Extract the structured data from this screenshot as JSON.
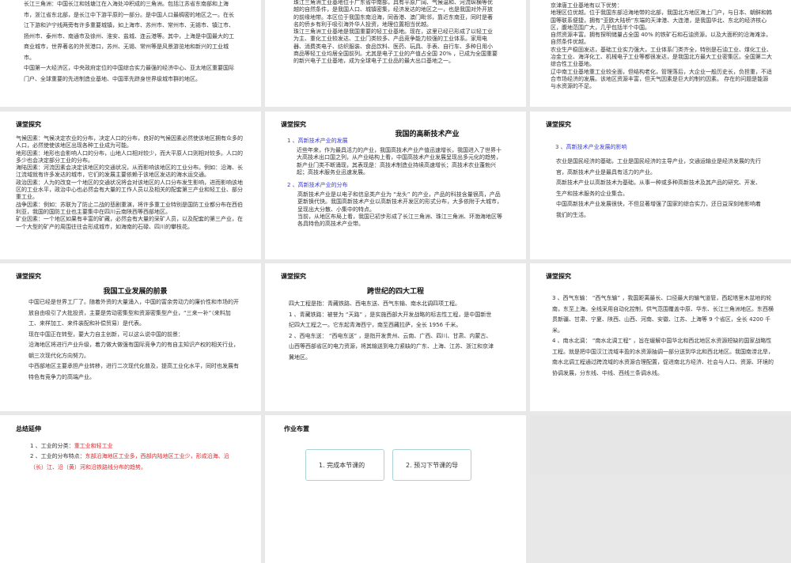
{
  "slides": {
    "s1": {
      "paragraphs": [
        "长江三角洲：中国长江和钱塘江在入海处冲积成的三角洲。包括江苏省东南部和上海市，浙江省东北部，是长江中下游平原的一部分。是中国人口最稠密的地区之一。在长江下游和沪宁线两旁有许多重要城镇，如上海市、苏州市、常州市、无锡市、镇江市、扬州市、泰州市、南通市及徐州、淮安、盐城、连云港等。其中，上海是中国最大的工商业城市，世界著名的外贸港口，苏州、无锡、常州等是风景游览地和新兴的工业城市。",
        "中国第一大经济区，中央政府定位的中国综合实力最强的经济中心、亚太地区重要国际门户、全球重要的先进制造业基地、中国率先跻身世界级城市群的地区。"
      ]
    },
    "s2": {
      "paragraphs": [
        "珠江三角洲工业基地位于广东省中南部，具有平原广阔、气候温和、河流纵横等优越的自然条件，是我国人口、城镇密集，经济发达的地区之一，也是我国对外开放的前缘地带。本区位于我国东南沿海，同香港、澳门毗邻，靠近东南亚，同时是著名的侨乡有利于吸引海外华人投资，地理位置相当优越。",
        "珠江三角洲工业基地是我国重要的轻工业基地。现在，这里已经已形成了以轻工业为主、重化工业较发达、工业门类较多、产品竞争能力较强的工业体系。家用电器、消费类电子、纺织服装、食品饮料、医药、玩具、手表、自行车、多种日用小商品等轻工业均居全国前列。尤其是电子工业的产值占全国 20% ，已成为全国重要的新兴电子工业基地，成为全球电子工业品的最大出口基地之一。"
      ]
    },
    "s3": {
      "paragraphs": [
        "京津唐工业基地有以下优势：",
        "地理区位优越。位于我国东部沿海地带的北部，我国北方地区海上门户，与日本、朝鲜和韩国等联系便捷，拥有“亚欧大陆桥”东端的天津港、大连港，是我国华北、东北的经济核心区，腹地范围广大，几乎包括半个中国。",
        "自然资源丰富。拥有探明储量占全国 40% 的铁矿石和石油资源，以及大面积的沿海滩涂，自然条件优越。",
        "农业生产稳固发达，基础工业实力强大，工业体系门类齐全，特别是石油工业、煤化工业、冶金工业、海洋化工、机械电子工业等都很发达，是我国北方最大工业密集区。全国第二大综合性工业基地。",
        "辽中南工业基地重工业较全面，但结构老化，管理落后，大企业一般历史长，负担重，不适合市场经济的发展。该地区资源丰富，但天气因素是巨大的制约因素。 存在的问题是能源与水资源的不足。"
      ]
    },
    "s4": {
      "header": "课堂探究",
      "paragraphs": [
        "气候因素：气候决定农业的分布，决定人口的分布，良好的气候因素必然使该地区拥有众多的人口，必然使使该地区出现各种工业成为可能。",
        "地形因素：地形也会影响人口的分布，山地人口相对较少，而大平原人口则相对较多。人口的多少也会决定部分工业的分布。",
        "海陆因素：河流因素会决定该地区的交通状况，从而影响该地区的工业分布。例如：沿海、长江流域就有许多发达的城市，它们的发展主要依赖于该地区发达的海水运交通。",
        "政治因素：人为的改变一个地区的交通状况将会对该地区的人口分布发生影响，进而影响该地区的工业水平，政治中心也必然会有大量的工作人员以及相关的配套第三产业和轻工业、部分重工业。",
        "战争因素：例如：苏联为了防止二战的悲剧重演，将许多重工业特别是国防工业都分布在西伯利亚，我国的国防工业也主要集中在四川云南陕西等西部地区。",
        "矿业因素：一个地区如果有丰富的矿藏，必然会有大量的采矿人员，以及配套的第三产业，在一个大型的矿产的周围往往会形成城市，如海南的石碌、四川的攀枝花。"
      ]
    },
    "s5": {
      "header": "课堂探究",
      "title": "我国的高新技术产业",
      "sub1": "1 、高新技术产业的发展",
      "p1": "近些年来，作为最具活力的产业，我国高技术产业产值迅速增长，我国进入了世界十大高技术出口国之列，从产业结构上看，中国高技术产业发展呈现出多元化的趋势，新产业门类不断涌现，其表现是：高技术制造业持续高速增长；高技术农业蓬勃兴起；高技术服务业迅速发展。",
      "sub2": "2 、高新技术产业的分布",
      "p2": "高新技术产业是以电子和信息类产业为 “龙头” 的产业，产品的科技含量很高，产品更新换代快。我国高新技术产业以高新技术开发区的形式分布，大多依附于大城市，呈现出大分散、小集中的特点。",
      "p3": "当前，从地区布局上看，我国已初步形成了长江三角洲、珠江三角洲、环渤海地区等各具特色的高技术产业带。"
    },
    "s6": {
      "header": "课堂探究",
      "sub": "3 、高新技术产业发展的影响",
      "paragraphs": [
        "农业是国民经济的基础，工业是国民经济的主导产业，交通运输业是经济发展的先行官，高新技术产业是最具有活力的产业。",
        "高新技术产业以高新技术为基础，从事一种或多种高新技术及其产品的研究、开发、生产和技术服务的企业集合。",
        "中国高新技术产业发展很快，不但显著增强了国家的综合实力，还日益深刻地影响着我们的生活。"
      ]
    },
    "s7": {
      "header": "课堂探究",
      "title": "我国工业发展的前景",
      "paragraphs": [
        "中国已经是世界工厂了。随着外资的大量涌入，中国的富余劳动力的廉价性和市场的开放自由吸引了大批投资，主要是劳动密集型和资源密集型产业，“三来一补”（来料加工、来样加工、来件装配和补偿贸易）是代表。",
        "现在中国正在转型，要大力自主创新，可以这么说中国的前景：",
        "沿海地区将进行产业升级，着力做大做强有国际竞争力的有自主知识产权的相关行业，朝三次现代化方向努力。",
        "中西部地区主要承担产业转移，进行二次现代化普及，提高工业化水平，同时也发展有特色有竞争力的高端产业。"
      ]
    },
    "s8": {
      "header": "课堂探究",
      "title": "跨世纪的四大工程",
      "paragraphs": [
        "四大工程是指：青藏铁路、西电东送、西气东输、南水北调四项工程。",
        "1 、青藏铁路：被誉为 “天路” ，是实施西部大开发战略的标志性工程，是中国新世纪四大工程之一。它东起青海西宁，南至西藏拉萨，全长 1956 千米。",
        "2 、西电东送： “西电东送” ，是指开发贵州、云南、广西、四川、甘肃、内蒙古、山西等西部省区的电力资源，将其输送到电力紧缺的广东、上海、江苏、浙江和京津冀地区。"
      ]
    },
    "s9": {
      "header": "课堂探究",
      "paragraphs": [
        "3 、西气东输： “西气东输” ，我国距离最长、口径最大的输气道管，西起塔里木盆地的轮南，东至上海。全线采用自动化控制，供气范围覆盖中原、华东、长江三角洲地区。东西横贯新疆、甘肃、宁夏、陕西、山西、河南、安徽、江苏、上海等 9 个省区，全长 4200 千米。",
        "4 、南水北调： “南水北调工程” ，旨在缓解中国华北和西北地区水资源短缺的国家战略性工程。就是把中国汉江流域丰盈的水资源抽调一部分送到华北和西北地区。我国南涝北旱，南水北调工程通过跨流域的水资源合理配置，促进南北方经济、社会与人口、资源、环境的协调发展，分东线、中线、西线三条调水线。"
      ]
    },
    "s10": {
      "header": "总结延伸",
      "item1_label": "1 、工业的分类：",
      "item1_value": "重工业和轻工业",
      "item2_label": "2 、工业的分布特点：",
      "item2_value": "东部沿海地区工业多，西部内陆地区工业少，形成沿海、沿（长）江、沿（黄）河和沿铁路线分布的趋势。"
    },
    "s11": {
      "header": "作业布置",
      "box1": "1. 完成本节课的",
      "box2": "2. 预习下节课的导"
    }
  },
  "colors": {
    "accent_blue": "#3b3bd6",
    "accent_red": "#e0262b",
    "background": "#e8e8e8"
  }
}
